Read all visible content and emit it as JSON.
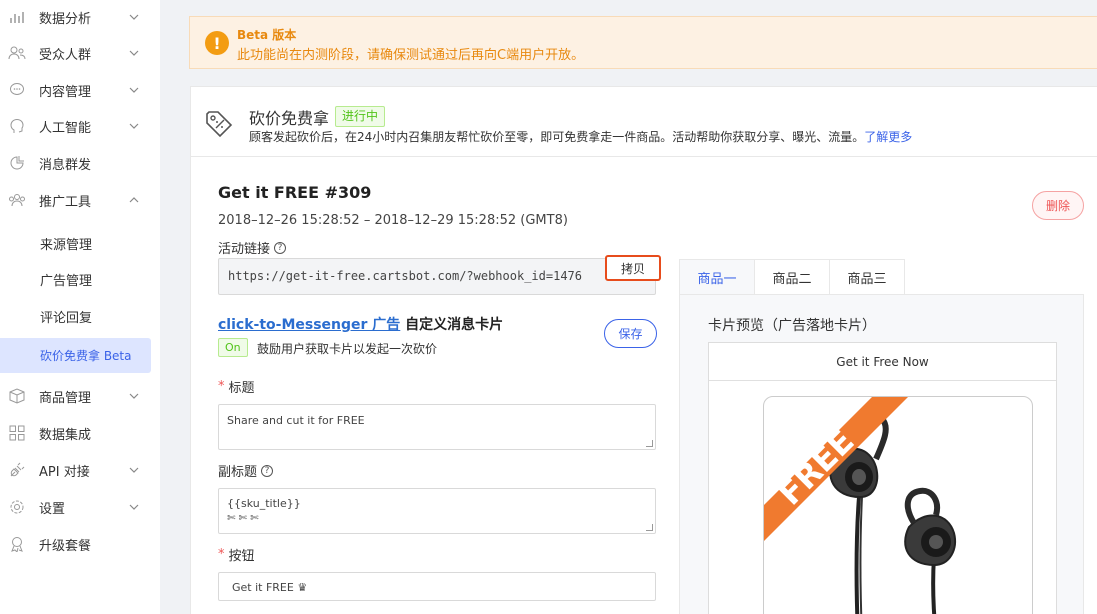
{
  "sidebar": {
    "items": [
      {
        "label": "数据分析",
        "icon": "chart-icon"
      },
      {
        "label": "受众人群",
        "icon": "users-icon"
      },
      {
        "label": "内容管理",
        "icon": "chat-icon"
      },
      {
        "label": "人工智能",
        "icon": "brain-icon"
      },
      {
        "label": "消息群发",
        "icon": "broadcast-icon"
      },
      {
        "label": "推广工具",
        "icon": "promote-icon"
      },
      {
        "label": "商品管理",
        "icon": "box-icon"
      },
      {
        "label": "数据集成",
        "icon": "grid-icon"
      },
      {
        "label": "API 对接",
        "icon": "plug-icon"
      },
      {
        "label": "设置",
        "icon": "gear-icon"
      },
      {
        "label": "升级套餐",
        "icon": "badge-icon"
      }
    ],
    "subitems": [
      "来源管理",
      "广告管理",
      "评论回复",
      "砍价免费拿 Beta"
    ]
  },
  "alert": {
    "title": "Beta 版本",
    "message": "此功能尚在内测阶段，请确保测试通过后再向C端用户开放。"
  },
  "feature": {
    "title": "砍价免费拿",
    "status": "进行中",
    "description": "顾客发起砍价后，在24小时内召集朋友帮忙砍价至零，即可免费拿走一件商品。活动帮助你获取分享、曝光、流量。",
    "learn_more": "了解更多"
  },
  "campaign": {
    "title": "Get it FREE #309",
    "dates": "2018–12–26 15:28:52 – 2018–12–29 15:28:52 (GMT8)",
    "delete_label": "删除",
    "link_label": "活动链接",
    "link_url": "https://get-it-free.cartsbot.com/?webhook_id=1476",
    "copy_label": "拷贝"
  },
  "card_settings": {
    "link_text": "click-to-Messenger 广告",
    "title_suffix": "自定义消息卡片",
    "toggle_label": "On",
    "toggle_desc": "鼓励用户获取卡片以发起一次砍价",
    "save_label": "保存",
    "title_label": "标题",
    "title_value": "Share and cut it for FREE",
    "subtitle_label": "副标题",
    "subtitle_line1": "{{sku_title}}",
    "subtitle_line2": "✄ ✄ ✄",
    "button_label": "按钮",
    "button_value": "Get it FREE ♛"
  },
  "tabs": [
    "商品一",
    "商品二",
    "商品三"
  ],
  "preview": {
    "title": "卡片预览（广告落地卡片）",
    "card_header": "Get it Free Now",
    "ribbon_text": "FREE"
  },
  "colors": {
    "accent": "#3b63e8",
    "warning": "#e8890f",
    "success": "#52c41a",
    "danger": "#e55555",
    "ribbon": "#f07a2f"
  }
}
